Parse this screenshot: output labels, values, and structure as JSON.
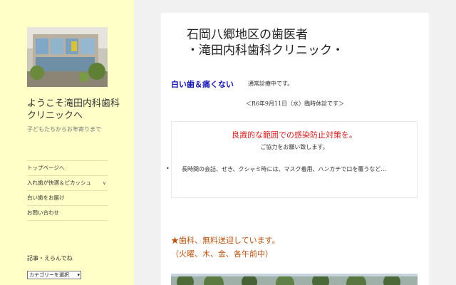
{
  "sidebar": {
    "site_title": "ようこそ滝田内科歯科クリニックへ",
    "site_description": "子どもたちからお年寄りまで",
    "nav_items": [
      {
        "label": "トップページへ",
        "has_children": false
      },
      {
        "label": "入れ歯が快適＆ピカッシュ",
        "has_children": true
      },
      {
        "label": "白い歯をお届け",
        "has_children": false
      },
      {
        "label": "お問い合わせ",
        "has_children": false
      }
    ],
    "toggle_icon": "chevron-down-icon",
    "widget_title": "記事・えらんでね",
    "category_select": {
      "selected": "カテゴリーを選択"
    }
  },
  "main": {
    "title_line1": "石岡八郷地区の歯医者",
    "title_line2": "・滝田内科歯科クリニック・",
    "white_teeth_heading": "白い歯＆痛くない",
    "status_text": "通常診療中です。",
    "closure_notice": "＜R6年9月11日（水）臨時休診です＞",
    "notice": {
      "heading": "良識的な範囲での感染防止対策を。",
      "subheading": "ご協力をお願い致します。",
      "bullet": "長時間の会話、せき、クシャミ時には、マスク着用、ハンカチで口を覆うなど…"
    },
    "transport_line1": "★歯科、無料送迎しています。",
    "transport_line2": "（火曜、木、金、各午前中）"
  },
  "colors": {
    "sidebar_bg": "#ffffc8",
    "heading_blue": "#1a1ab4",
    "notice_red": "#d42020",
    "transport_orange": "#b8500a"
  }
}
